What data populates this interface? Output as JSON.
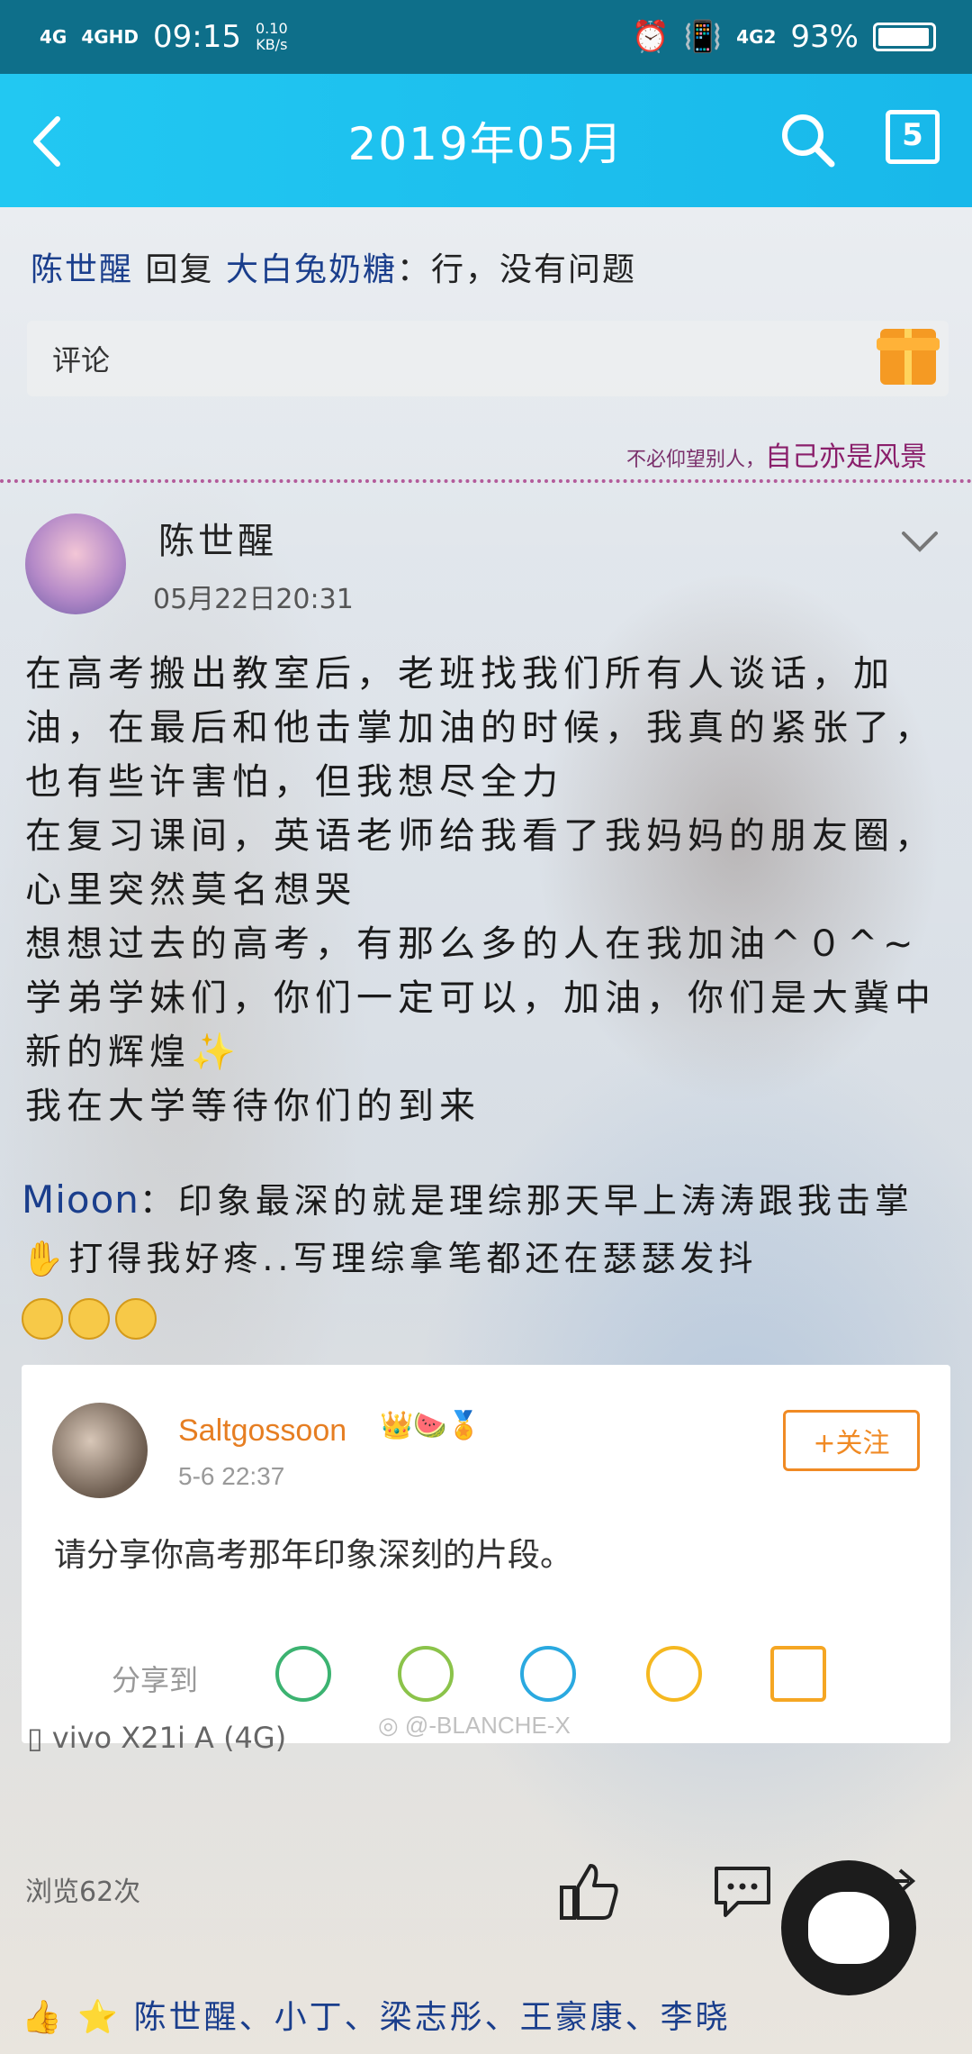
{
  "status_bar": {
    "signal_1": "4G",
    "signal_2": "4GHD",
    "time": "09:15",
    "speed": "0.10\nKB/s",
    "sim_label": "4G2",
    "battery": "93%"
  },
  "nav": {
    "title": "2019年05月",
    "back_icon": "chevron-left-icon",
    "search_icon": "search-icon",
    "calendar_icon": "calendar-icon",
    "calendar_day": "5"
  },
  "reply": {
    "user": "陈世醒",
    "action": "回复",
    "target": "大白兔奶糖",
    "text": "：行，没有问题"
  },
  "comment_box": {
    "placeholder": "评论"
  },
  "divider": {
    "small_text": "不必仰望别人，",
    "big_text": "自己亦是风景"
  },
  "post": {
    "author": "陈世醒",
    "time": "05月22日20:31",
    "body": "在高考搬出教室后，老班找我们所有人谈话，加油，在最后和他击掌加油的时候，我真的紧张了，也有些许害怕，但我想尽全力\n在复习课间，英语老师给我看了我妈妈的朋友圈，心里突然莫名想哭\n想想过去的高考，有那么多的人在我加油^０^~\n学弟学妹们，你们一定可以，加油，你们是大冀中新的辉煌✨\n我在大学等待你们的到来"
  },
  "quoted_comment": {
    "user": "Mioon",
    "text": "：印象最深的就是理综那天早上涛涛跟我击掌✋打得我好疼..写理综拿笔都还在瑟瑟发抖"
  },
  "share_card": {
    "username": "Saltgossoon",
    "time": "5-6 22:37",
    "follow_label": "+关注",
    "text": "请分享你高考那年印象深刻的片段。",
    "share_label": "分享到",
    "icons": [
      "wechat-icon",
      "moments-icon",
      "qq-icon",
      "favorite-star-icon",
      "save-image-icon"
    ]
  },
  "watermark": "@-BLANCHE-X",
  "device": "vivo X21i A (4G)",
  "views": "浏览62次",
  "likers": "陈世醒、小丁、梁志彤、王豪康、李晓"
}
